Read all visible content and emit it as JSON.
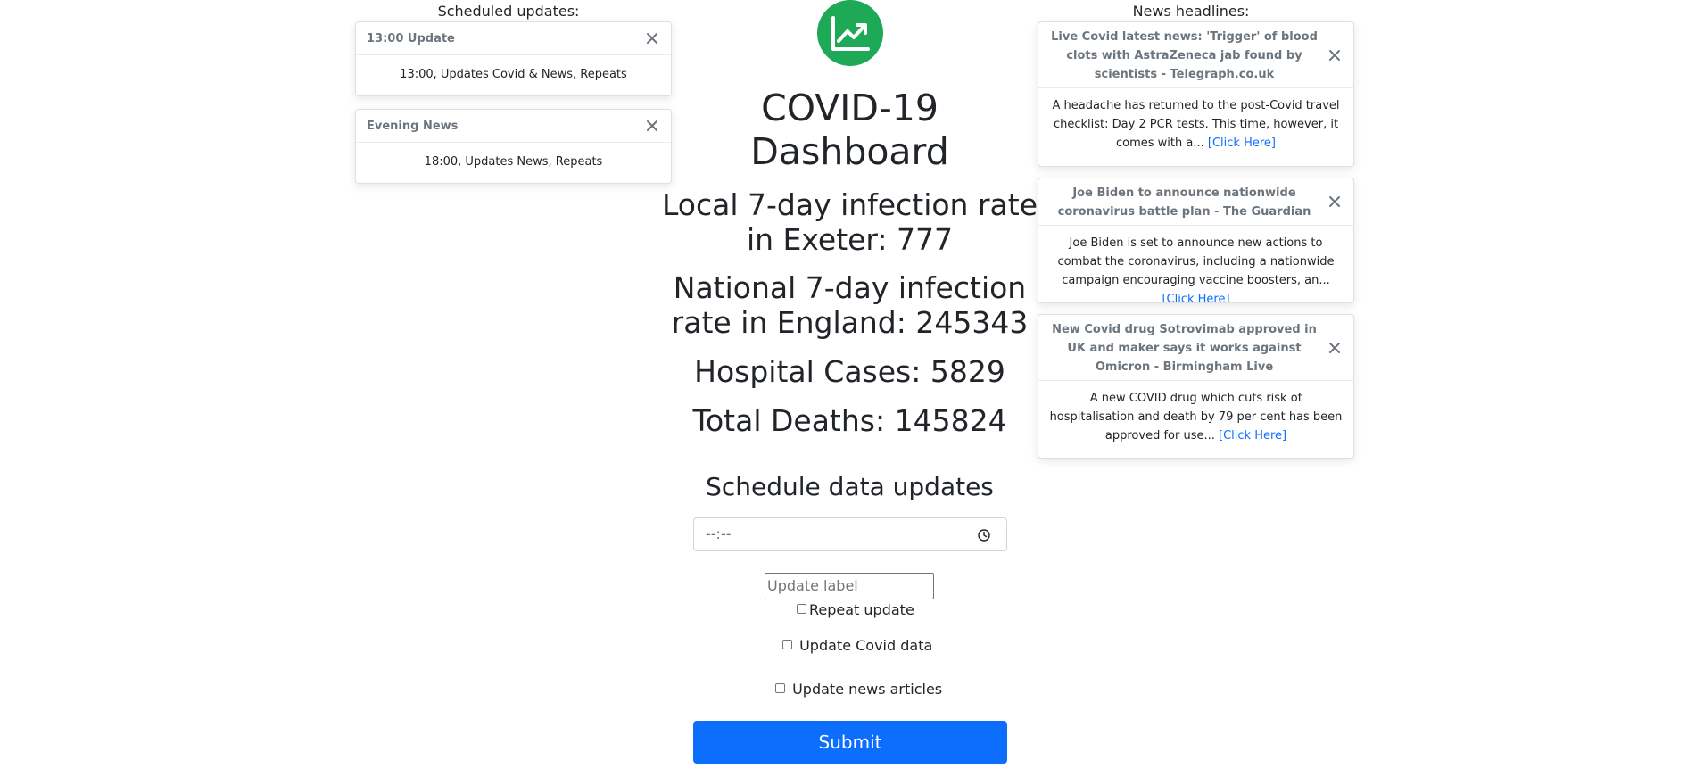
{
  "scheduled_updates": {
    "title": "Scheduled updates:",
    "items": [
      {
        "label": "13:00 Update",
        "detail": "13:00, Updates Covid & News, Repeats"
      },
      {
        "label": "Evening News",
        "detail": "18:00, Updates News, Repeats"
      }
    ]
  },
  "dashboard": {
    "title": "COVID-19 Dashboard",
    "logo_icon": "trending-up-chart-icon",
    "logo_color": "#1da955",
    "local_rate": "Local 7-day infection rate in Exeter: 777",
    "national_rate": "National 7-day infection rate in England: 245343",
    "hospital_cases": "Hospital Cases: 5829",
    "total_deaths": "Total Deaths: 145824"
  },
  "schedule_form": {
    "heading": "Schedule data updates",
    "time_value": "--:--",
    "label_placeholder": "Update label",
    "repeat_label": "Repeat update",
    "covid_label": "Update Covid data",
    "news_label": "Update news articles",
    "submit_label": "Submit",
    "accent_color": "#0d6efd"
  },
  "news": {
    "title": "News headlines:",
    "link_text": "[Click Here]",
    "items": [
      {
        "headline": "Live Covid latest news: 'Trigger' of blood clots with AstraZeneca jab found by scientists - Telegraph.co.uk",
        "summary": "A headache has returned to the post-Covid travel checklist: Day 2 PCR tests. This time, however, it comes with a..."
      },
      {
        "headline": "Joe Biden to announce nationwide coronavirus battle plan - The Guardian",
        "summary": "Joe Biden is set to announce new actions to combat the coronavirus, including a nationwide campaign encouraging vaccine boosters, an..."
      },
      {
        "headline": "New Covid drug Sotrovimab approved in UK and maker says it works against Omicron - Birmingham Live",
        "summary": "A new COVID drug which cuts risk of hospitalisation and death by 79 per cent has been approved for use..."
      }
    ]
  }
}
